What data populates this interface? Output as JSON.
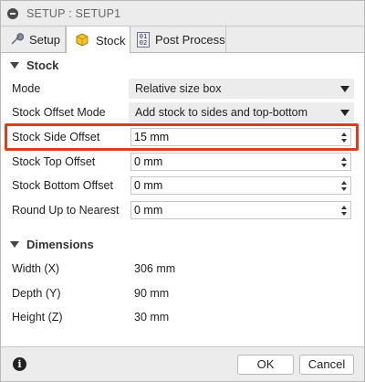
{
  "window": {
    "title": "SETUP : SETUP1"
  },
  "tabs": [
    {
      "label": "Setup",
      "icon": "wrench-icon"
    },
    {
      "label": "Stock",
      "icon": "stock-cube-icon"
    },
    {
      "label": "Post Process",
      "icon": "post-process-icon"
    }
  ],
  "active_tab": "Stock",
  "icons": {
    "post_process_glyph": "01\n02"
  },
  "colors": {
    "highlight": "#e23a1e",
    "stock_cube": "#f4c430"
  },
  "stock": {
    "heading": "Stock",
    "mode": {
      "label": "Mode",
      "value": "Relative size box"
    },
    "offset_mode": {
      "label": "Stock Offset Mode",
      "value": "Add stock to sides and top-bottom"
    },
    "side_offset": {
      "label": "Stock Side Offset",
      "value": "15 mm"
    },
    "top_offset": {
      "label": "Stock Top Offset",
      "value": "0 mm"
    },
    "bottom_offset": {
      "label": "Stock Bottom Offset",
      "value": "0 mm"
    },
    "round_up": {
      "label": "Round Up to Nearest",
      "value": "0 mm"
    }
  },
  "dimensions": {
    "heading": "Dimensions",
    "width": {
      "label": "Width (X)",
      "value": "306 mm"
    },
    "depth": {
      "label": "Depth (Y)",
      "value": "90 mm"
    },
    "height": {
      "label": "Height (Z)",
      "value": "30 mm"
    }
  },
  "footer": {
    "info": "i",
    "ok": "OK",
    "cancel": "Cancel"
  }
}
